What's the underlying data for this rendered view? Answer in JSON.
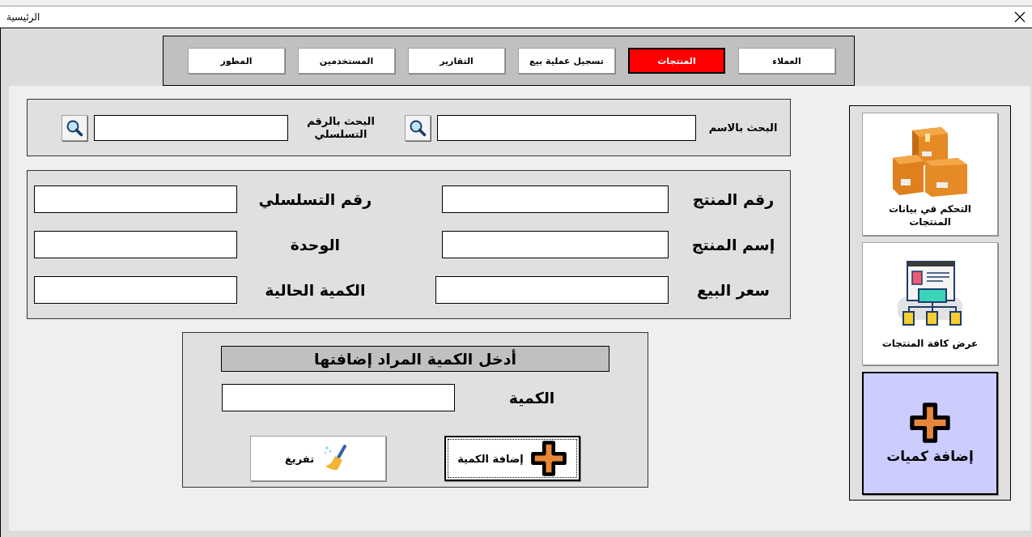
{
  "window": {
    "title": "الرئيسية"
  },
  "tabs": [
    {
      "label": "العملاء",
      "selected": false
    },
    {
      "label": "المنتجات",
      "selected": true
    },
    {
      "label": "تسجيل عملية بيع",
      "selected": false
    },
    {
      "label": "التقارير",
      "selected": false
    },
    {
      "label": "المستخدمين",
      "selected": false
    },
    {
      "label": "المطور",
      "selected": false
    }
  ],
  "search": [
    {
      "label": "البحث بالاسم"
    },
    {
      "label": "البحث بالرقم التسلسلي"
    }
  ],
  "fields": [
    {
      "label": "رقم المنتج"
    },
    {
      "label": "رقم التسلسلي"
    },
    {
      "label": "إسم المنتج"
    },
    {
      "label": "الوحدة"
    },
    {
      "label": "سعر البيع"
    },
    {
      "label": "الكمية الحالية"
    }
  ],
  "quantity": {
    "heading": "أدخل الكمية المراد إضافتها",
    "label": "الكمية",
    "buttons": [
      {
        "label": "إضافة الكمية",
        "kind": "add"
      },
      {
        "label": "تفريغ",
        "kind": "clear"
      }
    ]
  },
  "side_buttons": [
    {
      "label": "التحكم في بيانات المنتجات",
      "kind": "boxes",
      "selected": false
    },
    {
      "label": "عرض كافة المنتجات",
      "kind": "diagram",
      "selected": false
    },
    {
      "label": "إضافة كميات",
      "kind": "plus",
      "selected": true
    }
  ]
}
